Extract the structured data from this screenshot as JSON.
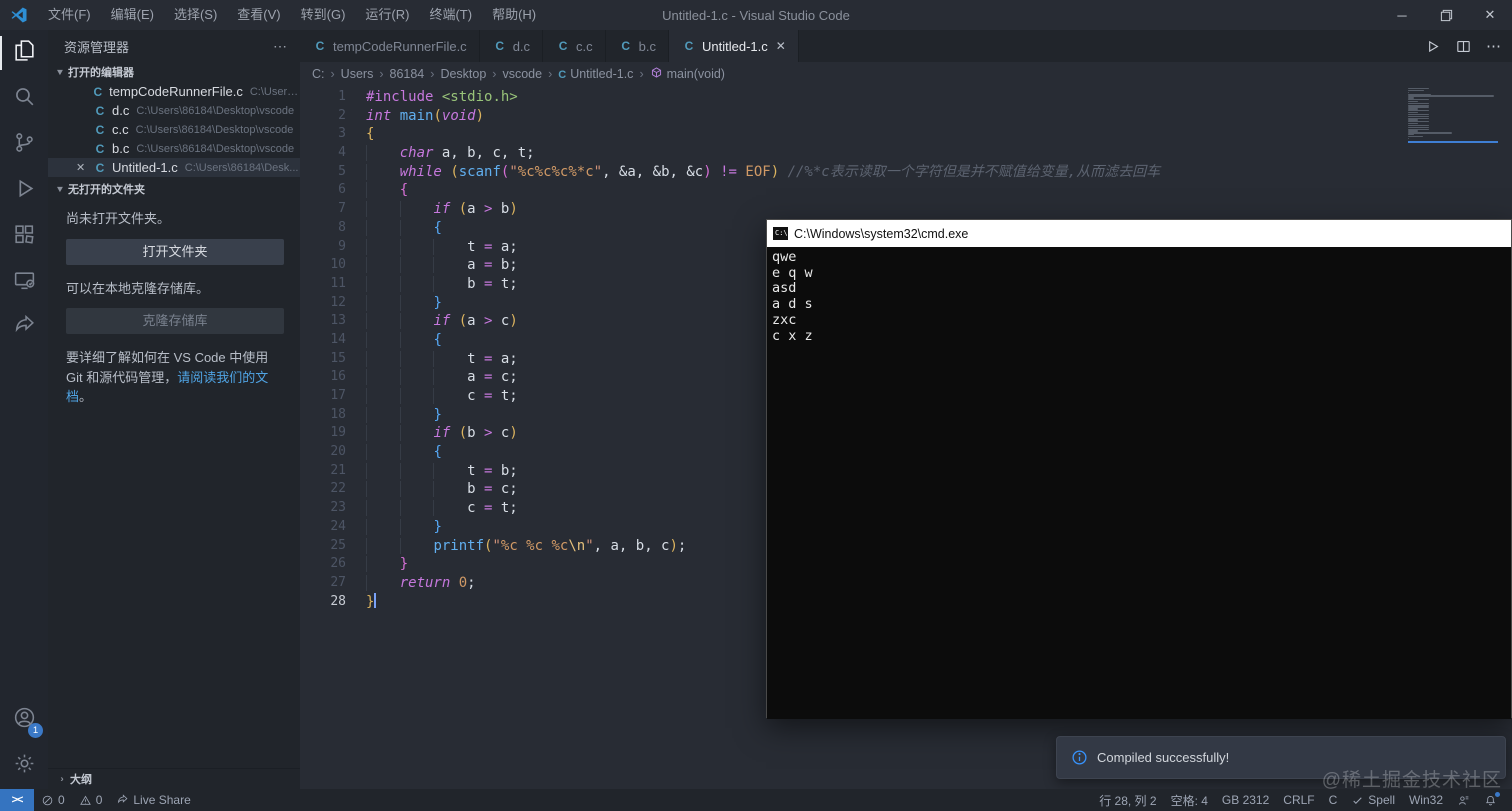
{
  "palette": {
    "pp": "#c678dd",
    "kw": "#c678dd",
    "fn": "#61afef",
    "inc": "#98c379",
    "str": "#ce9178",
    "fmt": "#d19a66",
    "esc": "#e5c07b",
    "const": "#d19a66",
    "num": "#d19a66",
    "op": "#c678dd",
    "var": "#d8dee6",
    "com": "#5c6370",
    "b1": "#dcb45f",
    "b2": "#d670d6",
    "b3": "#56a8f5",
    "accent_blue": "#3574c0",
    "info_blue": "#3794ff",
    "link_blue": "#4fa3e3",
    "c_icon": "#519aba",
    "symbol_purple": "#b180d7"
  },
  "title_bar": {
    "menus": [
      "文件(F)",
      "编辑(E)",
      "选择(S)",
      "查看(V)",
      "转到(G)",
      "运行(R)",
      "终端(T)",
      "帮助(H)"
    ],
    "title": "Untitled-1.c - Visual Studio Code",
    "minimize": "─",
    "close": "✕"
  },
  "activity_bar": {
    "top": [
      {
        "name": "explorer",
        "active": true
      },
      {
        "name": "search",
        "active": false
      },
      {
        "name": "source-control",
        "active": false
      },
      {
        "name": "run-debug",
        "active": false
      },
      {
        "name": "extensions",
        "active": false
      },
      {
        "name": "remote-explorer",
        "active": false
      },
      {
        "name": "live-share",
        "active": false
      }
    ],
    "bottom": [
      {
        "name": "accounts",
        "badge": "1"
      },
      {
        "name": "settings",
        "badge": ""
      }
    ]
  },
  "sidebar": {
    "header": "资源管理器",
    "more": "⋯",
    "open_editors_title": "打开的编辑器",
    "open_editors": [
      {
        "name": "tempCodeRunnerFile.c",
        "path": "C:\\Users\\...",
        "active": false
      },
      {
        "name": "d.c",
        "path": "C:\\Users\\86184\\Desktop\\vscode",
        "active": false
      },
      {
        "name": "c.c",
        "path": "C:\\Users\\86184\\Desktop\\vscode",
        "active": false
      },
      {
        "name": "b.c",
        "path": "C:\\Users\\86184\\Desktop\\vscode",
        "active": false
      },
      {
        "name": "Untitled-1.c",
        "path": "C:\\Users\\86184\\Desk...",
        "active": true,
        "close": "✕"
      }
    ],
    "no_folder_title": "无打开的文件夹",
    "no_folder_text": "尚未打开文件夹。",
    "open_folder_button": "打开文件夹",
    "clone_text": "可以在本地克隆存储库。",
    "clone_button": "克隆存储库",
    "docs_pre": "要详细了解如何在 VS Code 中使用 Git 和源代码管理，",
    "docs_link": "请阅读我们的文档",
    "docs_post": "。",
    "outline_title": "大纲",
    "outline_chevron": "›"
  },
  "tabs": [
    {
      "label": "tempCodeRunnerFile.c",
      "active": false
    },
    {
      "label": "d.c",
      "active": false
    },
    {
      "label": "c.c",
      "active": false
    },
    {
      "label": "b.c",
      "active": false
    },
    {
      "label": "Untitled-1.c",
      "active": true,
      "close": "✕"
    }
  ],
  "breadcrumb": [
    {
      "label": "C:",
      "icon": ""
    },
    {
      "label": "Users",
      "icon": ""
    },
    {
      "label": "86184",
      "icon": ""
    },
    {
      "label": "Desktop",
      "icon": ""
    },
    {
      "label": "vscode",
      "icon": ""
    },
    {
      "label": "Untitled-1.c",
      "icon": "c-file"
    },
    {
      "label": "main(void)",
      "icon": "symbol-method"
    }
  ],
  "editor": {
    "cursor_line": 28,
    "lines": [
      {
        "n": 1,
        "s": [
          [
            "#include",
            "pp"
          ],
          [
            " ",
            "var"
          ],
          [
            "<stdio.h>",
            "inc"
          ]
        ]
      },
      {
        "n": 2,
        "s": [
          [
            "int",
            "kw"
          ],
          [
            " ",
            "var"
          ],
          [
            "main",
            "fn"
          ],
          [
            "(",
            "b1"
          ],
          [
            "void",
            "kw"
          ],
          [
            ")",
            "b1"
          ]
        ]
      },
      {
        "n": 3,
        "s": [
          [
            "{",
            "b1"
          ]
        ]
      },
      {
        "n": 4,
        "s": [
          [
            "    ",
            "var"
          ],
          [
            "char",
            "kw"
          ],
          [
            " a, b, c, t;",
            "var"
          ]
        ]
      },
      {
        "n": 5,
        "s": [
          [
            "    ",
            "var"
          ],
          [
            "while",
            "kw"
          ],
          [
            " ",
            "var"
          ],
          [
            "(",
            "b1"
          ],
          [
            "scanf",
            "fn"
          ],
          [
            "(",
            "b2"
          ],
          [
            "\"",
            "str"
          ],
          [
            "%c%c%c%*c",
            "fmt"
          ],
          [
            "\"",
            "str"
          ],
          [
            ", &a, &b, &c",
            "var"
          ],
          [
            ")",
            "b2"
          ],
          [
            " ",
            "var"
          ],
          [
            "!=",
            "op"
          ],
          [
            " ",
            "var"
          ],
          [
            "EOF",
            "const"
          ],
          [
            ")",
            "b1"
          ],
          [
            " ",
            "var"
          ],
          [
            "//%*c表示读取一个字符但是并不赋值给变量,从而滤去回车",
            "com"
          ]
        ]
      },
      {
        "n": 6,
        "s": [
          [
            "    ",
            "var"
          ],
          [
            "{",
            "b2"
          ]
        ]
      },
      {
        "n": 7,
        "s": [
          [
            "        ",
            "var"
          ],
          [
            "if",
            "kw"
          ],
          [
            " ",
            "var"
          ],
          [
            "(",
            "b1"
          ],
          [
            "a ",
            "var"
          ],
          [
            ">",
            "op"
          ],
          [
            " b",
            "var"
          ],
          [
            ")",
            "b1"
          ]
        ]
      },
      {
        "n": 8,
        "s": [
          [
            "        ",
            "var"
          ],
          [
            "{",
            "b3"
          ]
        ]
      },
      {
        "n": 9,
        "s": [
          [
            "            ",
            "var"
          ],
          [
            "t ",
            "var"
          ],
          [
            "=",
            "op"
          ],
          [
            " a;",
            "var"
          ]
        ]
      },
      {
        "n": 10,
        "s": [
          [
            "            ",
            "var"
          ],
          [
            "a ",
            "var"
          ],
          [
            "=",
            "op"
          ],
          [
            " b;",
            "var"
          ]
        ]
      },
      {
        "n": 11,
        "s": [
          [
            "            ",
            "var"
          ],
          [
            "b ",
            "var"
          ],
          [
            "=",
            "op"
          ],
          [
            " t;",
            "var"
          ]
        ]
      },
      {
        "n": 12,
        "s": [
          [
            "        ",
            "var"
          ],
          [
            "}",
            "b3"
          ]
        ]
      },
      {
        "n": 13,
        "s": [
          [
            "        ",
            "var"
          ],
          [
            "if",
            "kw"
          ],
          [
            " ",
            "var"
          ],
          [
            "(",
            "b1"
          ],
          [
            "a ",
            "var"
          ],
          [
            ">",
            "op"
          ],
          [
            " c",
            "var"
          ],
          [
            ")",
            "b1"
          ]
        ]
      },
      {
        "n": 14,
        "s": [
          [
            "        ",
            "var"
          ],
          [
            "{",
            "b3"
          ]
        ]
      },
      {
        "n": 15,
        "s": [
          [
            "            ",
            "var"
          ],
          [
            "t ",
            "var"
          ],
          [
            "=",
            "op"
          ],
          [
            " a;",
            "var"
          ]
        ]
      },
      {
        "n": 16,
        "s": [
          [
            "            ",
            "var"
          ],
          [
            "a ",
            "var"
          ],
          [
            "=",
            "op"
          ],
          [
            " c;",
            "var"
          ]
        ]
      },
      {
        "n": 17,
        "s": [
          [
            "            ",
            "var"
          ],
          [
            "c ",
            "var"
          ],
          [
            "=",
            "op"
          ],
          [
            " t;",
            "var"
          ]
        ]
      },
      {
        "n": 18,
        "s": [
          [
            "        ",
            "var"
          ],
          [
            "}",
            "b3"
          ]
        ]
      },
      {
        "n": 19,
        "s": [
          [
            "        ",
            "var"
          ],
          [
            "if",
            "kw"
          ],
          [
            " ",
            "var"
          ],
          [
            "(",
            "b1"
          ],
          [
            "b ",
            "var"
          ],
          [
            ">",
            "op"
          ],
          [
            " c",
            "var"
          ],
          [
            ")",
            "b1"
          ]
        ]
      },
      {
        "n": 20,
        "s": [
          [
            "        ",
            "var"
          ],
          [
            "{",
            "b3"
          ]
        ]
      },
      {
        "n": 21,
        "s": [
          [
            "            ",
            "var"
          ],
          [
            "t ",
            "var"
          ],
          [
            "=",
            "op"
          ],
          [
            " b;",
            "var"
          ]
        ]
      },
      {
        "n": 22,
        "s": [
          [
            "            ",
            "var"
          ],
          [
            "b ",
            "var"
          ],
          [
            "=",
            "op"
          ],
          [
            " c;",
            "var"
          ]
        ]
      },
      {
        "n": 23,
        "s": [
          [
            "            ",
            "var"
          ],
          [
            "c ",
            "var"
          ],
          [
            "=",
            "op"
          ],
          [
            " t;",
            "var"
          ]
        ]
      },
      {
        "n": 24,
        "s": [
          [
            "        ",
            "var"
          ],
          [
            "}",
            "b3"
          ]
        ]
      },
      {
        "n": 25,
        "s": [
          [
            "        ",
            "var"
          ],
          [
            "printf",
            "fn"
          ],
          [
            "(",
            "b1"
          ],
          [
            "\"",
            "str"
          ],
          [
            "%c %c %c",
            "fmt"
          ],
          [
            "\\n",
            "esc"
          ],
          [
            "\"",
            "str"
          ],
          [
            ", a, b, c",
            "var"
          ],
          [
            ")",
            "b1"
          ],
          [
            ";",
            "var"
          ]
        ]
      },
      {
        "n": 26,
        "s": [
          [
            "    ",
            "var"
          ],
          [
            "}",
            "b2"
          ]
        ]
      },
      {
        "n": 27,
        "s": [
          [
            "    ",
            "var"
          ],
          [
            "return",
            "kw"
          ],
          [
            " ",
            "var"
          ],
          [
            "0",
            "num"
          ],
          [
            ";",
            "var"
          ]
        ]
      },
      {
        "n": 28,
        "s": [
          [
            "}",
            "b1"
          ]
        ]
      }
    ]
  },
  "cmd_window": {
    "title": "C:\\Windows\\system32\\cmd.exe",
    "lines": [
      "qwe",
      "e q w",
      "asd",
      "a d s",
      "zxc",
      "c x z"
    ]
  },
  "notification": {
    "text": "Compiled successfully!"
  },
  "watermark": "@稀土掘金技术社区",
  "status_bar": {
    "remote_glyph": "><",
    "left": [
      {
        "icon": "error-circle",
        "label": "0"
      },
      {
        "icon": "warning-triangle",
        "label": "0"
      },
      {
        "icon": "live-share",
        "label": "Live Share"
      }
    ],
    "right": [
      {
        "icon": "",
        "label": "行 28, 列 2"
      },
      {
        "icon": "",
        "label": "空格: 4"
      },
      {
        "icon": "",
        "label": "GB 2312"
      },
      {
        "icon": "",
        "label": "CRLF"
      },
      {
        "icon": "",
        "label": "C"
      },
      {
        "icon": "check",
        "label": "Spell"
      },
      {
        "icon": "",
        "label": "Win32"
      },
      {
        "icon": "feedback",
        "label": ""
      },
      {
        "icon": "bell",
        "label": ""
      }
    ]
  }
}
